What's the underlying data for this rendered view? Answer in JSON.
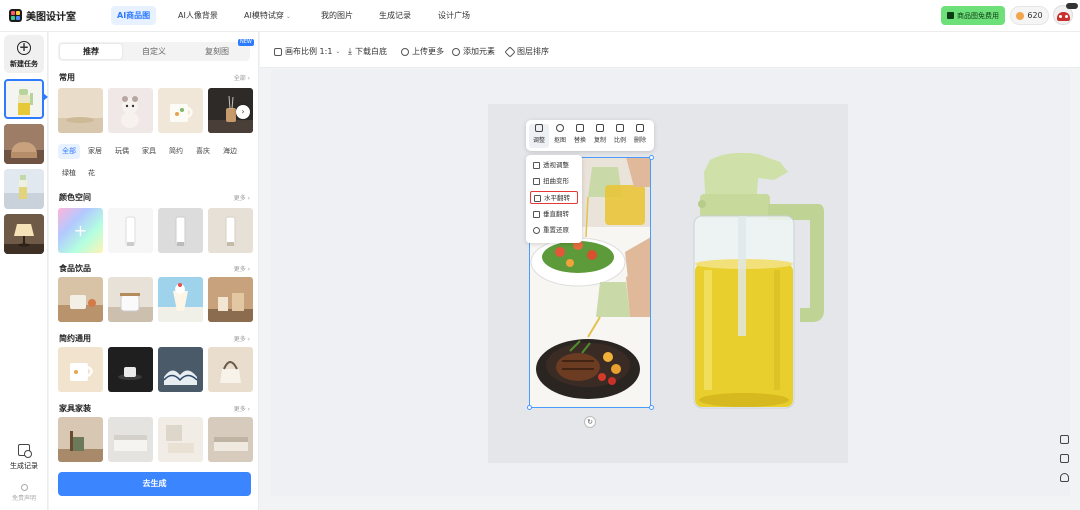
{
  "app": {
    "name": "美图设计室"
  },
  "nav": {
    "items": [
      {
        "label": "AI商品图",
        "active": true
      },
      {
        "label": "AI人像背景"
      },
      {
        "label": "AI模特试穿",
        "caret": "⌄"
      },
      {
        "label": "我的图片"
      },
      {
        "label": "生成记录"
      },
      {
        "label": "设计广场"
      }
    ],
    "promo_label": "商品图免费用",
    "points": "620"
  },
  "rail": {
    "new_task": "新建任务",
    "history": "生成记录",
    "disclaimer": "免责声明"
  },
  "panel": {
    "tabs": [
      "推荐",
      "自定义",
      "复刻图"
    ],
    "new_badge": "NEW",
    "sections": {
      "common": {
        "title": "常用",
        "more": "全部 ›"
      },
      "color_space": {
        "title": "颜色空间",
        "more": "更多 ›"
      },
      "food": {
        "title": "食品饮品",
        "more": "更多 ›"
      },
      "simple": {
        "title": "简约通用",
        "more": "更多 ›"
      },
      "furniture": {
        "title": "家具家装",
        "more": "更多 ›"
      }
    },
    "chips": [
      "全部",
      "家居",
      "玩偶",
      "家具",
      "简约",
      "喜庆",
      "海边",
      "绿植",
      "花"
    ],
    "generate_label": "去生成"
  },
  "toolbar": {
    "ratio": "画布比例 1:1",
    "download": "下载白底",
    "upload": "上传更多",
    "add": "添加元素",
    "layers": "图层排序"
  },
  "context_toolbar": {
    "items": [
      "调整",
      "抠图",
      "替换",
      "复制",
      "比例",
      "删除"
    ]
  },
  "adjust_menu": {
    "items": [
      "透视调整",
      "扭曲变形",
      "水平翻转",
      "垂直翻转",
      "重置还原"
    ],
    "highlighted": "水平翻转"
  },
  "colors": {
    "accent": "#2f7bff",
    "promo": "#6ee07a",
    "generate": "#3b86ff",
    "highlight": "#e53935"
  }
}
